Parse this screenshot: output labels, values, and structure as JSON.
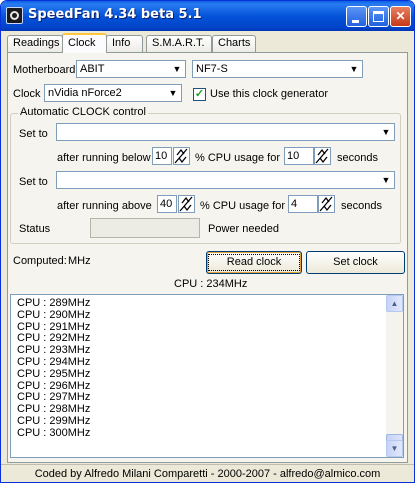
{
  "window": {
    "title": "SpeedFan 4.34 beta 5.1"
  },
  "tabs": [
    {
      "label": "Readings"
    },
    {
      "label": "Clock",
      "active": true
    },
    {
      "label": "Info"
    },
    {
      "label": "S.M.A.R.T."
    },
    {
      "label": "Charts"
    }
  ],
  "clock": {
    "motherboard_label": "Motherboard",
    "motherboard_vendor": "ABIT",
    "motherboard_model": "NF7-S",
    "clock_label": "Clock",
    "clock_generator": "nVidia nForce2",
    "use_generator_label": "Use this clock generator",
    "use_generator_checked": true,
    "auto": {
      "title": "Automatic CLOCK control",
      "set_to_label": "Set to",
      "below": {
        "set_to_value": "",
        "prefix": "after running below",
        "cpu_pct": "10",
        "middle": "% CPU usage for",
        "seconds": "10",
        "suffix": "seconds"
      },
      "above": {
        "set_to_value": "",
        "prefix": "after running above",
        "cpu_pct": "40",
        "middle": "% CPU usage for",
        "seconds": "4",
        "suffix": "seconds"
      },
      "status_label": "Status",
      "status_value": "",
      "power_text": "Power needed"
    },
    "computed_label": "Computed:",
    "computed_value": "MHz",
    "read_clock_label": "Read clock",
    "set_clock_label": "Set clock",
    "cpu_readout": "CPU : 234MHz",
    "log": [
      "CPU : 289MHz",
      "CPU : 290MHz",
      "CPU : 291MHz",
      "CPU : 292MHz",
      "CPU : 293MHz",
      "CPU : 294MHz",
      "CPU : 295MHz",
      "CPU : 296MHz",
      "CPU : 297MHz",
      "CPU : 298MHz",
      "CPU : 299MHz",
      "CPU : 300MHz"
    ]
  },
  "statusbar": {
    "text": "Coded by Alfredo Milani Comparetti - 2000-2007 - alfredo@almico.com"
  },
  "icons": {
    "app": "speedfan-fan-icon",
    "minimize": "minimize-icon",
    "maximize": "maximize-icon",
    "close": "close-icon",
    "combo_arrow": "chevron-down-icon",
    "spin": "spin-arrows-icon",
    "checkmark": "checkmark-icon"
  }
}
